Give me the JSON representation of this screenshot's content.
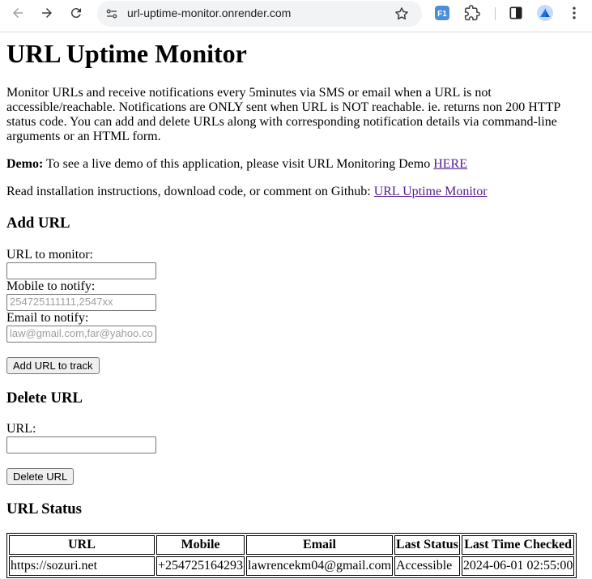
{
  "browser": {
    "url": "url-uptime-monitor.onrender.com",
    "ext_badge": "F1"
  },
  "page": {
    "title": "URL Uptime Monitor",
    "intro": "Monitor URLs and receive notifications every 5minutes via SMS or email when a URL is not accessible/reachable. Notifications are ONLY sent when URL is NOT reachable. ie. returns non 200 HTTP status code. You can add and delete URLs along with corresponding notification details via command-line arguments or an HTML form.",
    "demo_label": "Demo:",
    "demo_text": " To see a live demo of this application, please visit URL Monitoring Demo ",
    "demo_link": "HERE",
    "github_text": "Read installation instructions, download code, or comment on Github: ",
    "github_link": "URL Uptime Monitor"
  },
  "add_url": {
    "heading": "Add URL",
    "url_label": "URL to monitor:",
    "url_value": "",
    "mobile_label": "Mobile to notify:",
    "mobile_placeholder": "254725111111,2547xx",
    "email_label": "Email to notify:",
    "email_placeholder": "law@gmail.com,far@yahoo.co",
    "submit_label": "Add URL to track"
  },
  "delete_url": {
    "heading": "Delete URL",
    "url_label": "URL:",
    "url_value": "",
    "submit_label": "Delete URL"
  },
  "status": {
    "heading": "URL Status",
    "columns": [
      "URL",
      "Mobile",
      "Email",
      "Last Status",
      "Last Time Checked"
    ],
    "rows": [
      [
        "https://sozuri.net",
        "+254725164293",
        "lawrencekm04@gmail.com",
        "Accessible",
        "2024-06-01 02:55:00"
      ]
    ]
  },
  "colors": {
    "link": "#551a8b",
    "omnibox_bg": "#f1f3f4",
    "ext_blue": "#1a73e8"
  }
}
